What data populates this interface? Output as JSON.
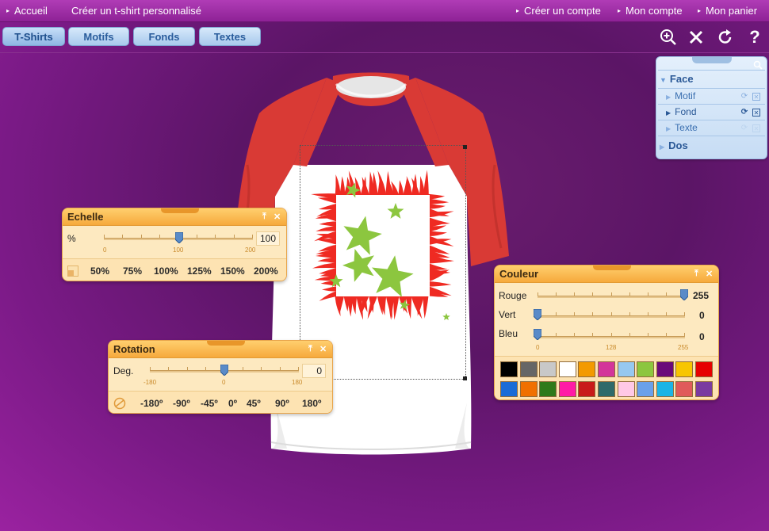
{
  "topbar": {
    "left": [
      {
        "label": "Accueil",
        "arrow": "▸"
      },
      {
        "label": "Créer un t-shirt personnalisé"
      }
    ],
    "right": [
      {
        "label": "Créer un compte",
        "arrow": "▸"
      },
      {
        "label": "Mon compte",
        "arrow": "▸"
      },
      {
        "label": "Mon panier",
        "arrow": "▸"
      }
    ]
  },
  "toolbar": {
    "tabs": [
      "T-Shirts",
      "Motifs",
      "Fonds",
      "Textes"
    ],
    "icons": [
      "zoom-in-icon",
      "close-x-icon",
      "redo-icon",
      "help-icon"
    ],
    "help_glyph": "?"
  },
  "layers": {
    "face_label": "Face",
    "items": [
      "Motif",
      "Fond",
      "Texte"
    ],
    "dos_label": "Dos"
  },
  "echelle": {
    "title": "Echelle",
    "row_label": "%",
    "value": "100",
    "scale": [
      "0",
      "100",
      "200"
    ],
    "presets": [
      "50%",
      "75%",
      "100%",
      "125%",
      "150%",
      "200%"
    ]
  },
  "rotation": {
    "title": "Rotation",
    "row_label": "Deg.",
    "value": "0",
    "scale": [
      "-180",
      "0",
      "180"
    ],
    "presets": [
      "-180º",
      "-90º",
      "-45º",
      "0º",
      "45º",
      "90º",
      "180º"
    ]
  },
  "couleur": {
    "title": "Couleur",
    "rows": [
      {
        "label": "Rouge",
        "value": "255"
      },
      {
        "label": "Vert",
        "value": "0"
      },
      {
        "label": "Bleu",
        "value": "0"
      }
    ],
    "scale": [
      "0",
      "128",
      "255"
    ],
    "palette_row1": [
      "#000000",
      "#666666",
      "#c8c8c8",
      "#ffffff",
      "#f39a00",
      "#d3359a",
      "#96c8f0",
      "#8cc63f",
      "#6a0a7a",
      "#f7c600",
      "#e60000"
    ],
    "palette_row2": [
      "#1a6bd6",
      "#f07000",
      "#2f7a1a",
      "#ff1aa6",
      "#c81a1a",
      "#2f6a6a",
      "#ffc8e6",
      "#6aa0ea",
      "#1ab4e6",
      "#e05a5a",
      "#7a3aa0"
    ]
  },
  "colors": {
    "topbar": "#9a2aa2",
    "panel_orange": "#f6a93c",
    "panel_blue": "#c6dcf4",
    "shirt_sleeve": "#d93a35",
    "design_red": "#ef2a22",
    "design_green": "#8cc63f"
  }
}
